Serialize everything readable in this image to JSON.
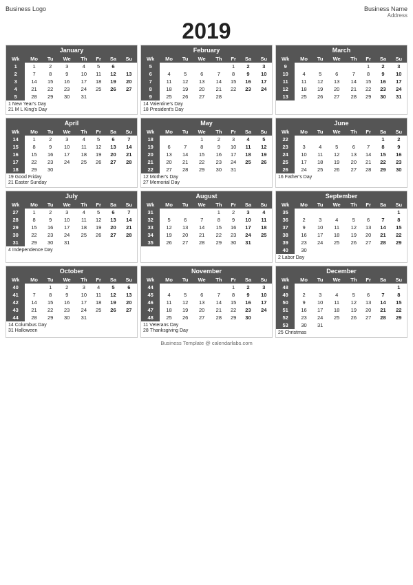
{
  "header": {
    "logo": "Business Logo",
    "year": "2019",
    "name": "Business Name",
    "address": "Address"
  },
  "footer": "Business Template @ calendarlabs.com",
  "months": [
    {
      "name": "January",
      "weeks": [
        [
          "1",
          "1",
          "2",
          "3",
          "4",
          "5",
          "6"
        ],
        [
          "2",
          "7",
          "8",
          "9",
          "10",
          "11",
          "12",
          "13"
        ],
        [
          "3",
          "14",
          "15",
          "16",
          "17",
          "18",
          "19",
          "20"
        ],
        [
          "4",
          "21",
          "22",
          "23",
          "24",
          "25",
          "26",
          "27"
        ],
        [
          "5",
          "28",
          "29",
          "30",
          "31",
          "",
          "",
          ""
        ]
      ],
      "holidays": [
        {
          "num": "1",
          "name": "New Year's Day"
        },
        {
          "num": "21",
          "name": "M L King's Day"
        }
      ]
    },
    {
      "name": "February",
      "weeks": [
        [
          "5",
          "",
          "",
          "",
          "",
          "1",
          "2",
          "3"
        ],
        [
          "6",
          "4",
          "5",
          "6",
          "7",
          "8",
          "9",
          "10"
        ],
        [
          "7",
          "11",
          "12",
          "13",
          "14",
          "15",
          "16",
          "17"
        ],
        [
          "8",
          "18",
          "19",
          "20",
          "21",
          "22",
          "23",
          "24"
        ],
        [
          "9",
          "25",
          "26",
          "27",
          "28",
          "",
          "",
          ""
        ]
      ],
      "holidays": [
        {
          "num": "14",
          "name": "Valentine's Day"
        },
        {
          "num": "18",
          "name": "President's Day"
        }
      ]
    },
    {
      "name": "March",
      "weeks": [
        [
          "9",
          "",
          "",
          "",
          "",
          "1",
          "2",
          "3"
        ],
        [
          "10",
          "4",
          "5",
          "6",
          "7",
          "8",
          "9",
          "10"
        ],
        [
          "11",
          "11",
          "12",
          "13",
          "14",
          "15",
          "16",
          "17"
        ],
        [
          "12",
          "18",
          "19",
          "20",
          "21",
          "22",
          "23",
          "24"
        ],
        [
          "13",
          "25",
          "26",
          "27",
          "28",
          "29",
          "30",
          "31"
        ]
      ],
      "holidays": []
    },
    {
      "name": "April",
      "weeks": [
        [
          "14",
          "1",
          "2",
          "3",
          "4",
          "5",
          "6",
          "7"
        ],
        [
          "15",
          "8",
          "9",
          "10",
          "11",
          "12",
          "13",
          "14"
        ],
        [
          "16",
          "15",
          "16",
          "17",
          "18",
          "19",
          "20",
          "21"
        ],
        [
          "17",
          "22",
          "23",
          "24",
          "25",
          "26",
          "27",
          "28"
        ],
        [
          "18",
          "29",
          "30",
          "",
          "",
          "",
          "",
          ""
        ]
      ],
      "holidays": [
        {
          "num": "19",
          "name": "Good Friday"
        },
        {
          "num": "21",
          "name": "Easter Sunday"
        }
      ]
    },
    {
      "name": "May",
      "weeks": [
        [
          "18",
          "",
          "",
          "1",
          "2",
          "3",
          "4",
          "5"
        ],
        [
          "19",
          "6",
          "7",
          "8",
          "9",
          "10",
          "11",
          "12"
        ],
        [
          "20",
          "13",
          "14",
          "15",
          "16",
          "17",
          "18",
          "19"
        ],
        [
          "21",
          "20",
          "21",
          "22",
          "23",
          "24",
          "25",
          "26"
        ],
        [
          "22",
          "27",
          "28",
          "29",
          "30",
          "31",
          "",
          ""
        ]
      ],
      "holidays": [
        {
          "num": "12",
          "name": "Mother's Day"
        },
        {
          "num": "27",
          "name": "Memorial Day"
        }
      ]
    },
    {
      "name": "June",
      "weeks": [
        [
          "22",
          "",
          "",
          "",
          "",
          "",
          "1",
          "2"
        ],
        [
          "23",
          "3",
          "4",
          "5",
          "6",
          "7",
          "8",
          "9"
        ],
        [
          "24",
          "10",
          "11",
          "12",
          "13",
          "14",
          "15",
          "16"
        ],
        [
          "25",
          "17",
          "18",
          "19",
          "20",
          "21",
          "22",
          "23"
        ],
        [
          "26",
          "24",
          "25",
          "26",
          "27",
          "28",
          "29",
          "30"
        ]
      ],
      "holidays": [
        {
          "num": "16",
          "name": "Father's Day"
        }
      ]
    },
    {
      "name": "July",
      "weeks": [
        [
          "27",
          "1",
          "2",
          "3",
          "4",
          "5",
          "6",
          "7"
        ],
        [
          "28",
          "8",
          "9",
          "10",
          "11",
          "12",
          "13",
          "14"
        ],
        [
          "29",
          "15",
          "16",
          "17",
          "18",
          "19",
          "20",
          "21"
        ],
        [
          "30",
          "22",
          "23",
          "24",
          "25",
          "26",
          "27",
          "28"
        ],
        [
          "31",
          "29",
          "30",
          "31",
          "",
          "",
          "",
          ""
        ]
      ],
      "holidays": [
        {
          "num": "4",
          "name": "Independence Day"
        }
      ]
    },
    {
      "name": "August",
      "weeks": [
        [
          "31",
          "",
          "",
          "",
          "1",
          "2",
          "3",
          "4"
        ],
        [
          "32",
          "5",
          "6",
          "7",
          "8",
          "9",
          "10",
          "11"
        ],
        [
          "33",
          "12",
          "13",
          "14",
          "15",
          "16",
          "17",
          "18"
        ],
        [
          "34",
          "19",
          "20",
          "21",
          "22",
          "23",
          "24",
          "25"
        ],
        [
          "35",
          "26",
          "27",
          "28",
          "29",
          "30",
          "31",
          ""
        ]
      ],
      "holidays": []
    },
    {
      "name": "September",
      "weeks": [
        [
          "35",
          "",
          "",
          "",
          "",
          "",
          "",
          "1"
        ],
        [
          "36",
          "2",
          "3",
          "4",
          "5",
          "6",
          "7",
          "8"
        ],
        [
          "37",
          "9",
          "10",
          "11",
          "12",
          "13",
          "14",
          "15"
        ],
        [
          "38",
          "16",
          "17",
          "18",
          "19",
          "20",
          "21",
          "22"
        ],
        [
          "39",
          "23",
          "24",
          "25",
          "26",
          "27",
          "28",
          "29"
        ],
        [
          "40",
          "30",
          "",
          "",
          "",
          "",
          "",
          ""
        ]
      ],
      "holidays": [
        {
          "num": "2",
          "name": "Labor Day"
        }
      ]
    },
    {
      "name": "October",
      "weeks": [
        [
          "40",
          "",
          "1",
          "2",
          "3",
          "4",
          "5",
          "6"
        ],
        [
          "41",
          "7",
          "8",
          "9",
          "10",
          "11",
          "12",
          "13"
        ],
        [
          "42",
          "14",
          "15",
          "16",
          "17",
          "18",
          "19",
          "20"
        ],
        [
          "43",
          "21",
          "22",
          "23",
          "24",
          "25",
          "26",
          "27"
        ],
        [
          "44",
          "28",
          "29",
          "30",
          "31",
          "",
          "",
          ""
        ]
      ],
      "holidays": [
        {
          "num": "14",
          "name": "Columbus Day"
        },
        {
          "num": "31",
          "name": "Halloween"
        }
      ]
    },
    {
      "name": "November",
      "weeks": [
        [
          "44",
          "",
          "",
          "",
          "",
          "1",
          "2",
          "3"
        ],
        [
          "45",
          "4",
          "5",
          "6",
          "7",
          "8",
          "9",
          "10"
        ],
        [
          "46",
          "11",
          "12",
          "13",
          "14",
          "15",
          "16",
          "17"
        ],
        [
          "47",
          "18",
          "19",
          "20",
          "21",
          "22",
          "23",
          "24"
        ],
        [
          "48",
          "25",
          "26",
          "27",
          "28",
          "29",
          "30",
          ""
        ]
      ],
      "holidays": [
        {
          "num": "11",
          "name": "Veterans Day"
        },
        {
          "num": "28",
          "name": "Thanksgiving Day"
        }
      ]
    },
    {
      "name": "December",
      "weeks": [
        [
          "48",
          "",
          "",
          "",
          "",
          "",
          "",
          "1"
        ],
        [
          "49",
          "2",
          "3",
          "4",
          "5",
          "6",
          "7",
          "8"
        ],
        [
          "50",
          "9",
          "10",
          "11",
          "12",
          "13",
          "14",
          "15"
        ],
        [
          "51",
          "16",
          "17",
          "18",
          "19",
          "20",
          "21",
          "22"
        ],
        [
          "52",
          "23",
          "24",
          "25",
          "26",
          "27",
          "28",
          "29"
        ],
        [
          "53",
          "30",
          "31",
          "",
          "",
          "",
          "",
          ""
        ]
      ],
      "holidays": [
        {
          "num": "25",
          "name": "Christmas"
        }
      ]
    }
  ],
  "dayHeaders": [
    "Wk",
    "Mo",
    "Tu",
    "We",
    "Th",
    "Fr",
    "Sa",
    "Su"
  ]
}
